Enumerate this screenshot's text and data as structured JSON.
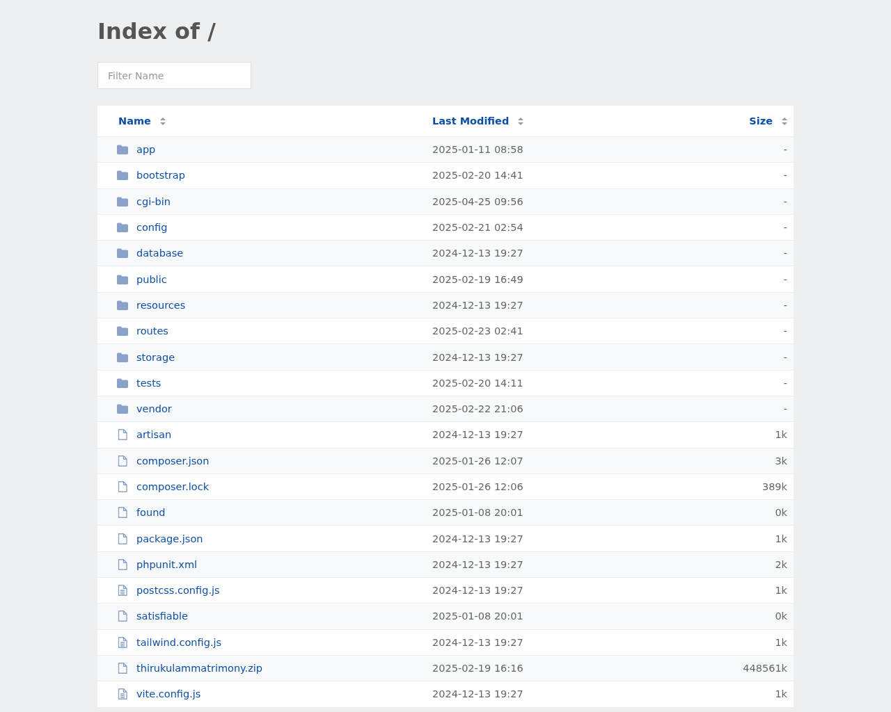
{
  "title": "Index of /",
  "filter": {
    "placeholder": "Filter Name"
  },
  "columns": [
    {
      "label": "Name"
    },
    {
      "label": "Last Modified"
    },
    {
      "label": "Size"
    }
  ],
  "rows": [
    {
      "kind": "folder",
      "name": "app",
      "modified": "2025-01-11 08:58",
      "size": "-"
    },
    {
      "kind": "folder",
      "name": "bootstrap",
      "modified": "2025-02-20 14:41",
      "size": "-"
    },
    {
      "kind": "folder",
      "name": "cgi-bin",
      "modified": "2025-04-25 09:56",
      "size": "-"
    },
    {
      "kind": "folder",
      "name": "config",
      "modified": "2025-02-21 02:54",
      "size": "-"
    },
    {
      "kind": "folder",
      "name": "database",
      "modified": "2024-12-13 19:27",
      "size": "-"
    },
    {
      "kind": "folder",
      "name": "public",
      "modified": "2025-02-19 16:49",
      "size": "-"
    },
    {
      "kind": "folder",
      "name": "resources",
      "modified": "2024-12-13 19:27",
      "size": "-"
    },
    {
      "kind": "folder",
      "name": "routes",
      "modified": "2025-02-23 02:41",
      "size": "-"
    },
    {
      "kind": "folder",
      "name": "storage",
      "modified": "2024-12-13 19:27",
      "size": "-"
    },
    {
      "kind": "folder",
      "name": "tests",
      "modified": "2025-02-20 14:11",
      "size": "-"
    },
    {
      "kind": "folder",
      "name": "vendor",
      "modified": "2025-02-22 21:06",
      "size": "-"
    },
    {
      "kind": "file",
      "name": "artisan",
      "modified": "2024-12-13 19:27",
      "size": "1k"
    },
    {
      "kind": "file",
      "name": "composer.json",
      "modified": "2025-01-26 12:07",
      "size": "3k"
    },
    {
      "kind": "file",
      "name": "composer.lock",
      "modified": "2025-01-26 12:06",
      "size": "389k"
    },
    {
      "kind": "file",
      "name": "found",
      "modified": "2025-01-08 20:01",
      "size": "0k"
    },
    {
      "kind": "file",
      "name": "package.json",
      "modified": "2024-12-13 19:27",
      "size": "1k"
    },
    {
      "kind": "file",
      "name": "phpunit.xml",
      "modified": "2024-12-13 19:27",
      "size": "2k"
    },
    {
      "kind": "text",
      "name": "postcss.config.js",
      "modified": "2024-12-13 19:27",
      "size": "1k"
    },
    {
      "kind": "file",
      "name": "satisfiable",
      "modified": "2025-01-08 20:01",
      "size": "0k"
    },
    {
      "kind": "text",
      "name": "tailwind.config.js",
      "modified": "2024-12-13 19:27",
      "size": "1k"
    },
    {
      "kind": "file",
      "name": "thirukulammatrimony.zip",
      "modified": "2025-02-19 16:16",
      "size": "448561k"
    },
    {
      "kind": "text",
      "name": "vite.config.js",
      "modified": "2024-12-13 19:27",
      "size": "1k"
    }
  ]
}
